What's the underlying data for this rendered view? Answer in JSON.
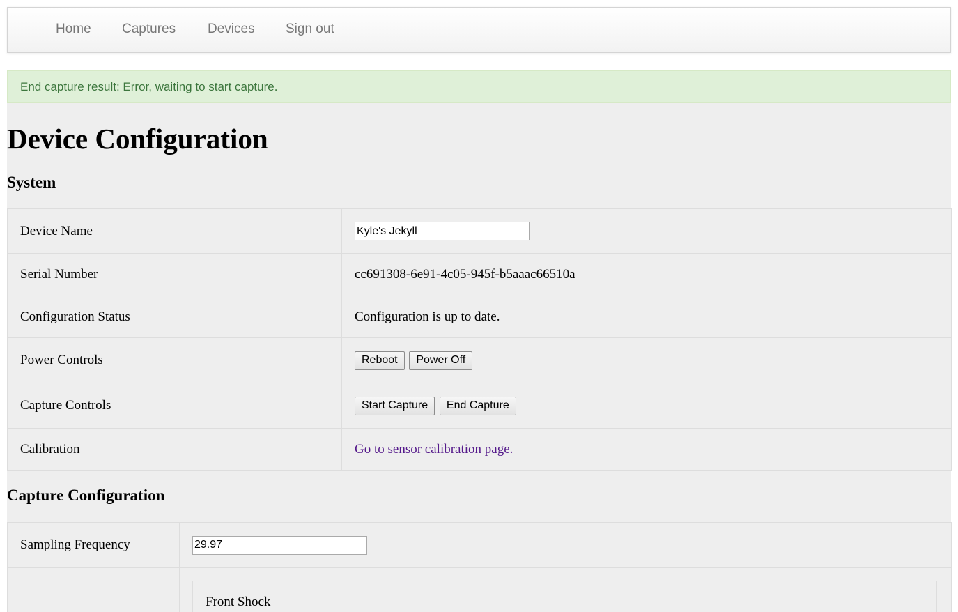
{
  "nav": {
    "items": [
      {
        "label": "Home"
      },
      {
        "label": "Captures"
      },
      {
        "label": "Devices"
      },
      {
        "label": "Sign out"
      }
    ]
  },
  "alert": {
    "message": "End capture result: Error, waiting to start capture.",
    "color": "#3c763d",
    "background": "#dff0d8"
  },
  "page": {
    "title": "Device Configuration"
  },
  "system": {
    "heading": "System",
    "device_name_label": "Device Name",
    "device_name_value": "Kyle's Jekyll",
    "serial_label": "Serial Number",
    "serial_value": "cc691308-6e91-4c05-945f-b5aaac66510a",
    "config_status_label": "Configuration Status",
    "config_status_value": "Configuration is up to date.",
    "power_label": "Power Controls",
    "reboot_label": "Reboot",
    "power_off_label": "Power Off",
    "capture_label": "Capture Controls",
    "start_capture_label": "Start Capture",
    "end_capture_label": "End Capture",
    "calibration_label": "Calibration",
    "calibration_link": "Go to sensor calibration page."
  },
  "capture_config": {
    "heading": "Capture Configuration",
    "sampling_label": "Sampling Frequency",
    "sampling_value": "29.97",
    "sensor_panel_title": "Front Shock"
  }
}
